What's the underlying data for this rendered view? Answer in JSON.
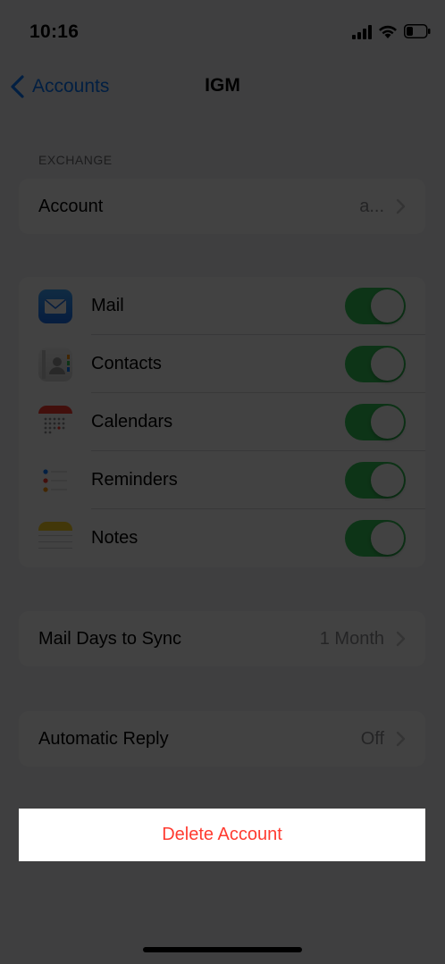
{
  "status_bar": {
    "time": "10:16"
  },
  "nav": {
    "back_label": "Accounts",
    "title": "IGM"
  },
  "section_header": "EXCHANGE",
  "account_row": {
    "label": "Account",
    "value": "a..."
  },
  "services": [
    {
      "label": "Mail",
      "icon": "mail-icon",
      "enabled": true
    },
    {
      "label": "Contacts",
      "icon": "contacts-icon",
      "enabled": true
    },
    {
      "label": "Calendars",
      "icon": "calendar-icon",
      "enabled": true
    },
    {
      "label": "Reminders",
      "icon": "reminders-icon",
      "enabled": true
    },
    {
      "label": "Notes",
      "icon": "notes-icon",
      "enabled": true
    }
  ],
  "mail_days_row": {
    "label": "Mail Days to Sync",
    "value": "1 Month"
  },
  "auto_reply_row": {
    "label": "Automatic Reply",
    "value": "Off"
  },
  "delete_account": {
    "label": "Delete Account"
  },
  "colors": {
    "accent": "#0a7aff",
    "toggle_on": "#34c759",
    "destructive": "#ff3b30"
  }
}
